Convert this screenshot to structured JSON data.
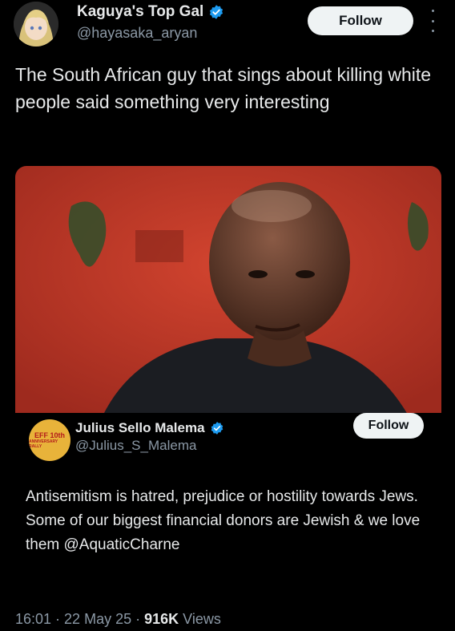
{
  "post": {
    "author": {
      "display_name": "Kaguya's Top Gal",
      "handle": "@hayasaka_aryan",
      "verified": true
    },
    "follow_label": "Follow",
    "text": "The South African guy that sings about killing white people said something very interesting",
    "meta": {
      "time": "16:01",
      "sep1": " · ",
      "date": "22 May 25",
      "sep2": " · ",
      "views_count": "916K",
      "views_label": " Views"
    }
  },
  "quote": {
    "author": {
      "display_name": "Julius Sello Malema",
      "handle": "@Julius_S_Malema",
      "verified": true,
      "avatar_line1": "EFF 10th",
      "avatar_line2": "ANNIVERSARY RALLY"
    },
    "follow_label": "Follow",
    "text": "Antisemitism is hatred, prejudice or hostility towards Jews. Some of our biggest financial donors are Jewish & we love them @AquaticCharne"
  },
  "colors": {
    "background": "#000000",
    "text": "#e7e9ea",
    "secondary": "#8b98a5",
    "verified_blue": "#1d9bf0",
    "photo_bg_red": "#c8392b"
  },
  "icons": [
    "verified-icon",
    "more-icon"
  ]
}
